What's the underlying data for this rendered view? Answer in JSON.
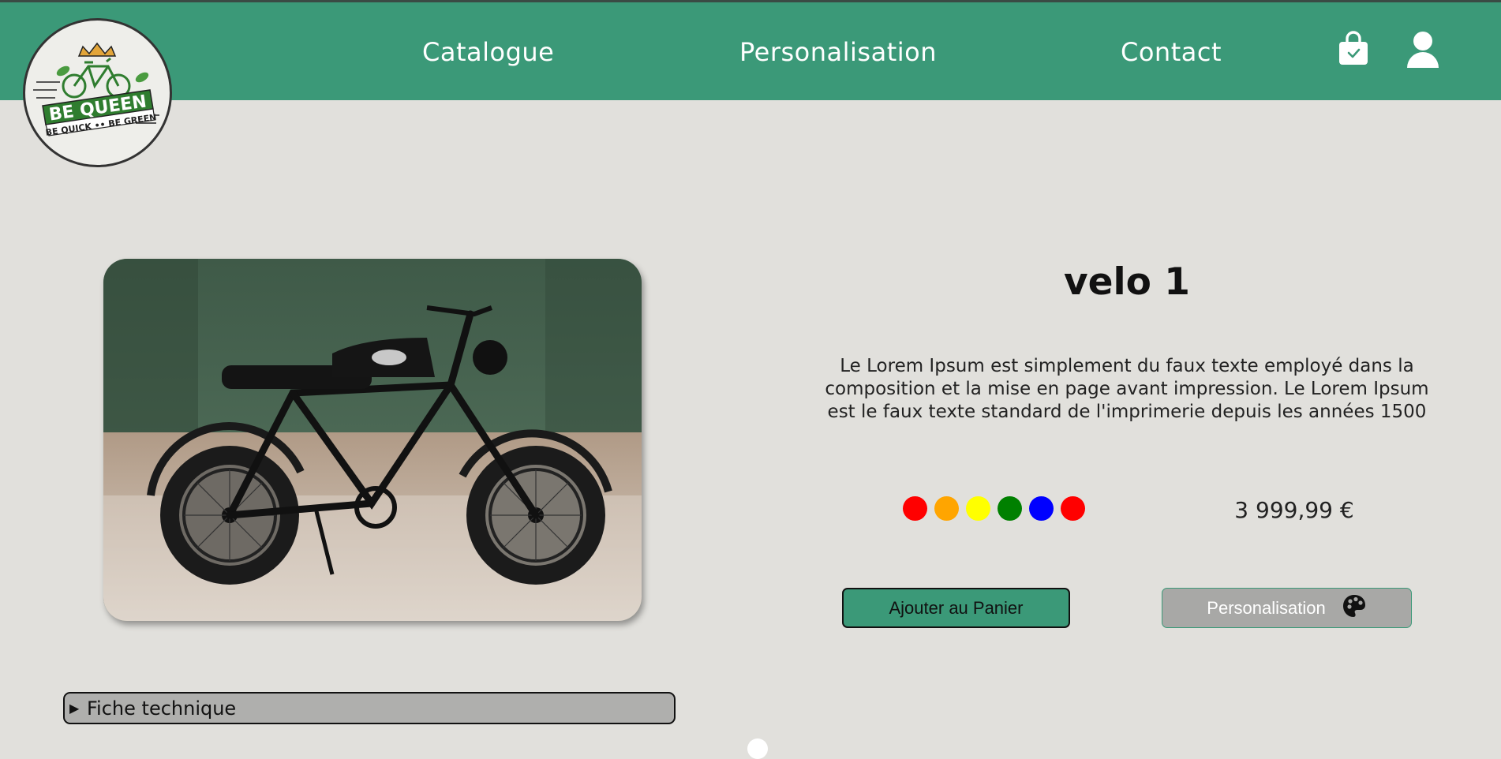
{
  "brand": {
    "logo_line1": "BE QUEEN",
    "logo_line2": "BE QUICK •• BE GREEN",
    "brand_color": "#3b9978"
  },
  "nav": {
    "items": [
      {
        "label": "Catalogue"
      },
      {
        "label": "Personalisation"
      },
      {
        "label": "Contact"
      }
    ],
    "cart_icon": "shopping-bag-check-icon",
    "account_icon": "user-icon"
  },
  "product": {
    "name": "velo 1",
    "description": "Le Lorem Ipsum est simplement du faux texte employé dans la composition et la mise en page avant impression. Le Lorem Ipsum est le faux texte standard de l'imprimerie depuis les années 1500",
    "price": "3 999,99 €",
    "colors": [
      "#ff0000",
      "#ffa500",
      "#ffff00",
      "#008000",
      "#0000ff",
      "#ff0000"
    ]
  },
  "actions": {
    "add_to_cart": "Ajouter au Panier",
    "personalise": "Personalisation",
    "personalise_icon": "palette-icon"
  },
  "specs": {
    "summary_label": "Fiche technique"
  }
}
